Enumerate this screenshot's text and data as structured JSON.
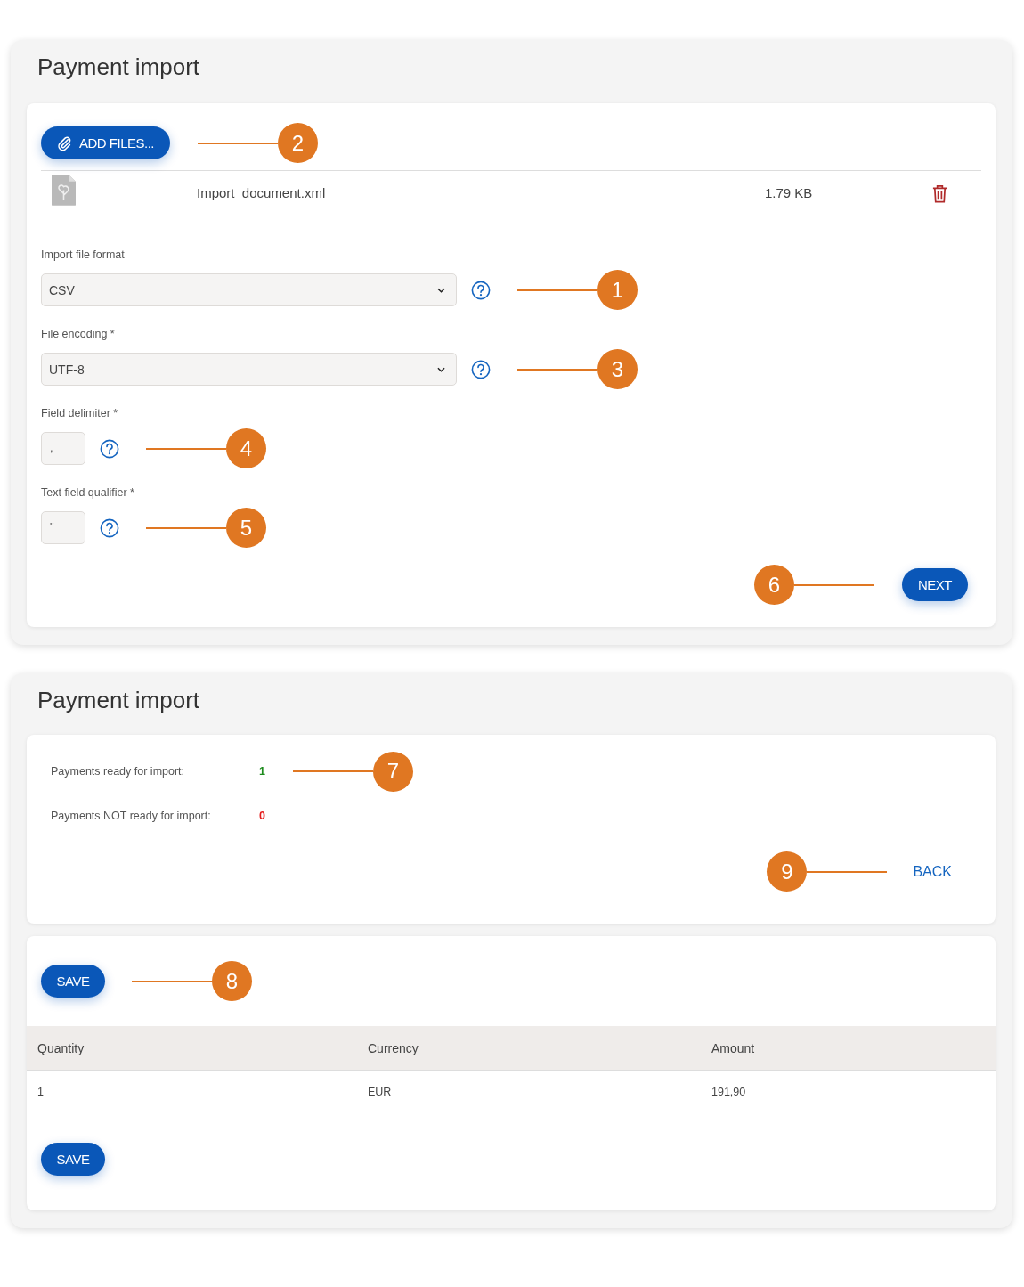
{
  "import_panel": {
    "title": "Payment import",
    "add_files_button": {
      "label": "ADD FILES...",
      "callout": "2"
    },
    "files": [
      {
        "name": "Import_document.xml",
        "size": "1.79 KB"
      }
    ],
    "fields": [
      {
        "kind": "select",
        "label": "Import file format",
        "value": "CSV",
        "callout": "1"
      },
      {
        "kind": "select",
        "label": "File encoding *",
        "value": "UTF-8",
        "callout": "3"
      },
      {
        "kind": "text",
        "label": "Field delimiter *",
        "value": ",",
        "callout": "4"
      },
      {
        "kind": "text",
        "label": "Text field qualifier *",
        "value": "\"",
        "callout": "5"
      }
    ],
    "next_button": {
      "label": "NEXT",
      "callout": "6"
    }
  },
  "result_panel": {
    "title": "Payment import",
    "summary": [
      {
        "label": "Payments ready for import:",
        "value": "1",
        "color": "#1e8c1e",
        "callout": "7"
      },
      {
        "label": "Payments NOT ready for import:",
        "value": "0",
        "color": "#e51b1b"
      }
    ],
    "back_link": {
      "label": "BACK",
      "callout": "9"
    },
    "top_save_button": {
      "label": "SAVE",
      "callout": "8"
    },
    "table": {
      "columns": [
        "Quantity",
        "Currency",
        "Amount"
      ],
      "rows": [
        [
          "1",
          "EUR",
          "191,90"
        ]
      ]
    },
    "bottom_save_button": {
      "label": "SAVE"
    }
  }
}
